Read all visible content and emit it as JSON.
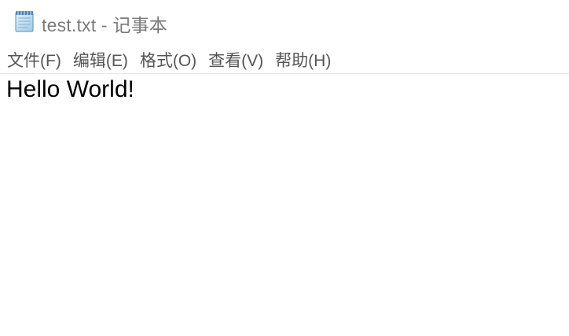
{
  "window": {
    "title": "test.txt - 记事本",
    "icon": "notepad-icon"
  },
  "menubar": {
    "items": [
      {
        "label": "文件(F)"
      },
      {
        "label": "编辑(E)"
      },
      {
        "label": "格式(O)"
      },
      {
        "label": "查看(V)"
      },
      {
        "label": "帮助(H)"
      }
    ]
  },
  "editor": {
    "content": "Hello World!"
  },
  "colors": {
    "title_text": "#7a7a7a",
    "menu_text": "#555555",
    "editor_text": "#000000",
    "background": "#ffffff"
  }
}
